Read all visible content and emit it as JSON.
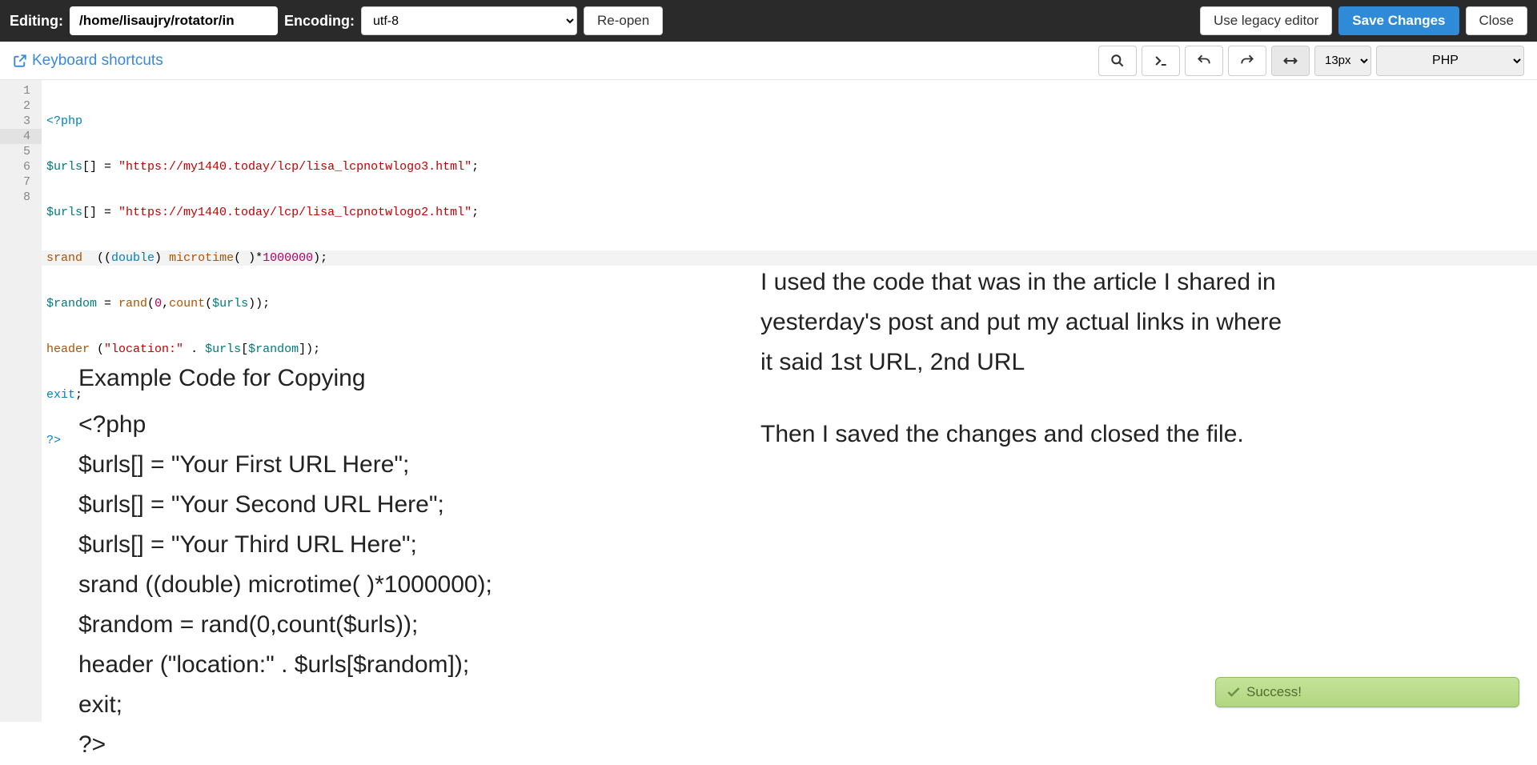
{
  "topbar": {
    "editing_label": "Editing:",
    "filepath": "/home/lisaujry/rotator/in",
    "encoding_label": "Encoding:",
    "encoding_value": "utf-8",
    "reopen": "Re-open",
    "legacy": "Use legacy editor",
    "save": "Save Changes",
    "close": "Close"
  },
  "toolbar": {
    "keyboard_shortcuts": "Keyboard shortcuts",
    "font_size": "13px",
    "language": "PHP"
  },
  "code": {
    "line_numbers": [
      "1",
      "2",
      "3",
      "4",
      "5",
      "6",
      "7",
      "8"
    ],
    "highlighted_line": 4,
    "l1_open": "<?php",
    "l2_var": "$urls",
    "l2_brackets": "[] = ",
    "l2_str": "\"https://my1440.today/lcp/lisa_lcpnotwlogo3.html\"",
    "l2_end": ";",
    "l3_var": "$urls",
    "l3_brackets": "[] = ",
    "l3_str": "\"https://my1440.today/lcp/lisa_lcpnotwlogo2.html\"",
    "l3_end": ";",
    "l4_fn": "srand",
    "l4_mid": "  ((",
    "l4_kw": "double",
    "l4_after": ") ",
    "l4_fn2": "microtime",
    "l4_paren": "( )*",
    "l4_num": "1000000",
    "l4_end": ");",
    "l5_var": "$random",
    "l5_eq": " = ",
    "l5_fn": "rand",
    "l5_open": "(",
    "l5_zero": "0",
    "l5_comma": ",",
    "l5_fn2": "count",
    "l5_p2": "(",
    "l5_var2": "$urls",
    "l5_end": "));",
    "l6_fn": "header",
    "l6_open": " (",
    "l6_str": "\"location:\"",
    "l6_dot": " . ",
    "l6_var": "$urls",
    "l6_br": "[",
    "l6_var2": "$random",
    "l6_end": "]);",
    "l7_kw": "exit",
    "l7_end": ";",
    "l8": "?>"
  },
  "overlay_left": {
    "heading": "Example Code for Copying",
    "l1": "<?php",
    "l2": "$urls[] = \"Your First URL Here\";",
    "l3": "$urls[] = \"Your Second URL Here\";",
    "l4": "$urls[] = \"Your Third URL Here\";",
    "l5": "srand  ((double) microtime( )*1000000);",
    "l6": "$random = rand(0,count($urls));",
    "l7": "header (\"location:\" . $urls[$random]);",
    "l8": "exit;",
    "l9": "?>"
  },
  "overlay_right": {
    "p1": "I used the code that was in the article I shared in yesterday's post and put my actual links in where it said 1st URL, 2nd URL",
    "p2": "Then I saved the changes and closed the file."
  },
  "success": {
    "label": "Success!"
  }
}
